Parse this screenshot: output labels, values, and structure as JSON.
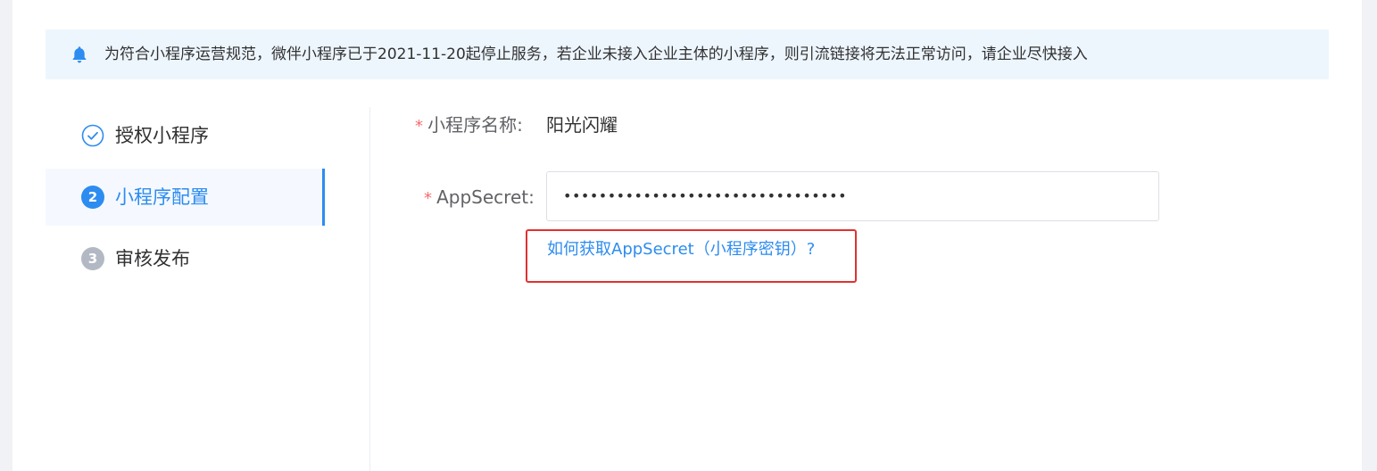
{
  "notice": {
    "icon": "bell-icon",
    "text": "为符合小程序运营规范，微伴小程序已于2021-11-20起停止服务，若企业未接入企业主体的小程序，则引流链接将无法正常访问，请企业尽快接入"
  },
  "steps": [
    {
      "label": "授权小程序",
      "status": "done",
      "icon": "check-circle-icon"
    },
    {
      "label": "小程序配置",
      "status": "active",
      "number": "2"
    },
    {
      "label": "审核发布",
      "status": "pending",
      "number": "3"
    }
  ],
  "form": {
    "name_required": "*",
    "name_label": "小程序名称:",
    "name_value": "阳光闪耀",
    "secret_required": "*",
    "secret_label": "AppSecret:",
    "secret_value": "••••••••••••••••••••••••••••••••",
    "help_link": "如何获取AppSecret（小程序密钥）?"
  },
  "colors": {
    "accent": "#2d8cf0",
    "required": "#f56c6c",
    "highlight_box": "#e03131",
    "notice_bg": "#eef6fd"
  }
}
